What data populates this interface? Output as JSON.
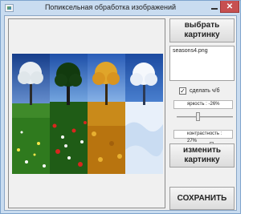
{
  "window": {
    "title": "Попиксельная обработка изображений",
    "close_glyph": "✕"
  },
  "buttons": {
    "choose": "выбрать картинку",
    "change": "изменить картинку",
    "save": "СОХРАНИТЬ"
  },
  "file": {
    "name": "seasons4.png"
  },
  "grayscale": {
    "label": "сделать ч/б",
    "checked": true,
    "check_glyph": "✓"
  },
  "brightness": {
    "label": "яркость : -26%",
    "value_percent": -26
  },
  "contrast": {
    "label": "контрастность : 27%",
    "value_percent": 27
  },
  "image": {
    "panels": [
      "winter-tree-snow-field",
      "summer-tree-flower-meadow",
      "autumn-tree-leaves",
      "snowy-tree-drifts"
    ]
  }
}
